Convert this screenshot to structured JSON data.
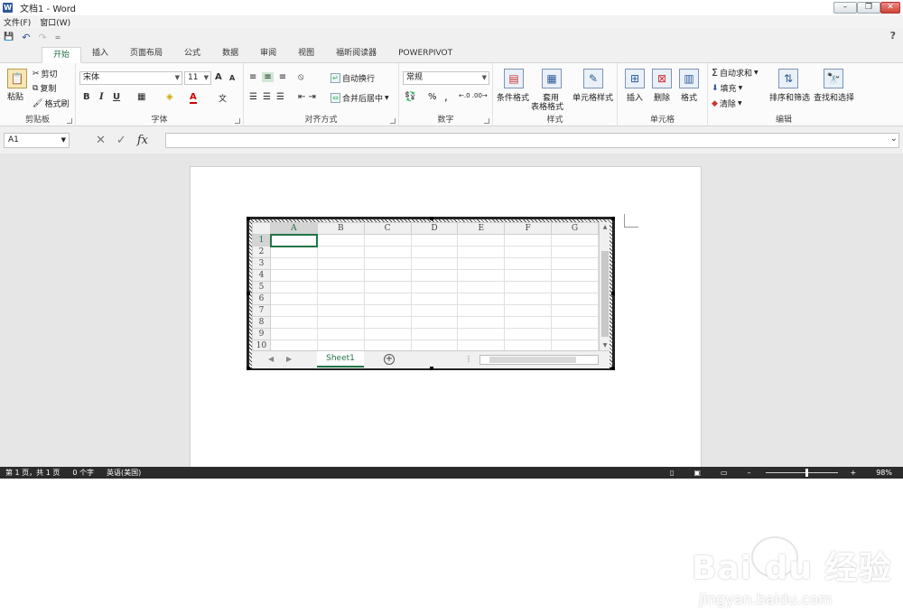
{
  "window": {
    "title": "文档1 - Word",
    "app_icon": "W",
    "controls": {
      "minimize": "–",
      "restore": "❐",
      "close": "✕"
    }
  },
  "menubar": {
    "items": [
      "文件(F)",
      "窗口(W)"
    ]
  },
  "qat": {
    "save": "💾",
    "undo": "↶",
    "redo": "↷",
    "customize": "=",
    "help": "?"
  },
  "tabs": [
    "开始",
    "插入",
    "页面布局",
    "公式",
    "数据",
    "审阅",
    "视图",
    "福昕阅读器",
    "POWERPIVOT"
  ],
  "ribbon": {
    "clipboard": {
      "label": "剪贴板",
      "paste": "粘贴",
      "cut": "剪切",
      "copy": "复制",
      "format_painter": "格式刷"
    },
    "font": {
      "label": "字体",
      "font_name": "宋体",
      "font_size": "11",
      "bold": "B",
      "italic": "I",
      "underline": "U",
      "grow": "A",
      "shrink": "A"
    },
    "alignment": {
      "label": "对齐方式",
      "wrap_text": "自动换行",
      "merge_center": "合并后居中"
    },
    "number": {
      "label": "数字",
      "format": "常规",
      "percent": "%",
      "comma": ","
    },
    "styles": {
      "label": "样式",
      "conditional": "条件格式",
      "table_format_1": "套用",
      "table_format_2": "表格格式",
      "cell_styles": "单元格样式"
    },
    "cells": {
      "label": "单元格",
      "insert": "插入",
      "delete": "删除",
      "format": "格式"
    },
    "editing": {
      "label": "编辑",
      "autosum": "自动求和",
      "fill": "填充",
      "clear": "清除",
      "sort_filter": "排序和筛选",
      "find_select": "查找和选择"
    }
  },
  "formula_bar": {
    "name_box": "A1",
    "fx": "fx",
    "cancel": "✕",
    "enter": "✓",
    "value": ""
  },
  "sheet": {
    "columns": [
      "A",
      "B",
      "C",
      "D",
      "E",
      "F",
      "G"
    ],
    "rows": [
      "1",
      "2",
      "3",
      "4",
      "5",
      "6",
      "7",
      "8",
      "9",
      "10"
    ],
    "tab_name": "Sheet1",
    "add_sheet": "+"
  },
  "status": {
    "page": "第 1 页，共 1 页",
    "words": "0 个字",
    "language": "英语(美国)",
    "zoom": "98%",
    "zoom_minus": "–",
    "zoom_plus": "+"
  },
  "watermark": {
    "brand": "Bai du 经验",
    "url": "jingyan.baidu.com"
  },
  "colors": {
    "accent": "#217346",
    "word_blue": "#2b579a",
    "status_bg": "#2b2b2b"
  }
}
